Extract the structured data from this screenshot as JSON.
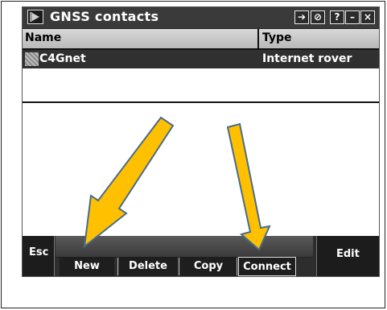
{
  "window": {
    "title": "GNSS contacts",
    "buttons": {
      "ok": "➔",
      "close_circle": "⊘",
      "help": "?",
      "minimize": "–",
      "close": "×"
    }
  },
  "table": {
    "headers": {
      "name": "Name",
      "type": "Type"
    },
    "rows": [
      {
        "name": "C4Gnet",
        "type": "Internet rover"
      }
    ]
  },
  "softkeys": {
    "esc": "Esc",
    "new": "New",
    "delete": "Delete",
    "copy": "Copy",
    "connect": "Connect",
    "edit": "Edit"
  },
  "colors": {
    "arrow_fill": "#FFC000",
    "arrow_stroke": "#4A6B8A"
  }
}
